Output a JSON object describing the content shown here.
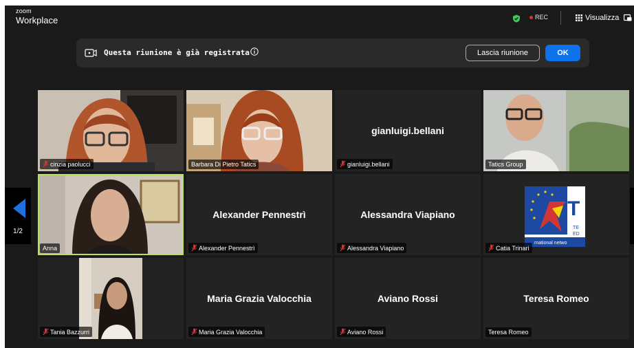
{
  "topbar": {
    "brand_line1": "zoom",
    "brand_line2": "Workplace",
    "rec_label": "REC",
    "view_label": "Visualizza",
    "icons": [
      "shield-check-icon",
      "grid-icon",
      "minimize-icon"
    ]
  },
  "banner": {
    "message": "Questa riunione è già registrata",
    "leave_label": "Lascia riunione",
    "ok_label": "OK"
  },
  "nav": {
    "page": "1/2"
  },
  "colors": {
    "background": "#1a1a1a",
    "tile": "#232323",
    "accent_blue": "#0e72ed",
    "active_speaker": "#b9e15a",
    "muted_red": "#e02f2f",
    "shield_green": "#3cc85b"
  },
  "participants": [
    {
      "name": "cinzia paolucci",
      "label": "cinzia paolucci",
      "muted": true
    },
    {
      "name": "Barbara Di Pietro Tatics",
      "label": "Barbara Di Pietro Tatics",
      "muted": false
    },
    {
      "name": "gianluigi.bellani",
      "label": "gianluigi.bellani",
      "muted": true
    },
    {
      "name": "Tatics Group",
      "label": "Tatics Group",
      "muted": false
    },
    {
      "name": "Anna",
      "label": "Anna",
      "muted": false
    },
    {
      "name": "Alexander Pennestrì",
      "label": "Alexander Pennestrì",
      "muted": true
    },
    {
      "name": "Alessandra Viapiano",
      "label": "Alessandra Viapiano",
      "muted": true
    },
    {
      "name": "Catia Trinari",
      "label": "Catia Trinari",
      "muted": true
    },
    {
      "name": "Tania Bazzurri",
      "label": "Tania Bazzurri",
      "muted": true
    },
    {
      "name": "Maria Grazia Valocchia",
      "label": "Maria Grazia Valocchia",
      "muted": true
    },
    {
      "name": "Aviano Rossi",
      "label": "Aviano Rossi",
      "muted": true
    },
    {
      "name": "Teresa Romeo",
      "label": "Teresa Romeo",
      "muted": false
    }
  ],
  "logo_text": [
    "T",
    "TE",
    "ED",
    "rnational netwo"
  ]
}
